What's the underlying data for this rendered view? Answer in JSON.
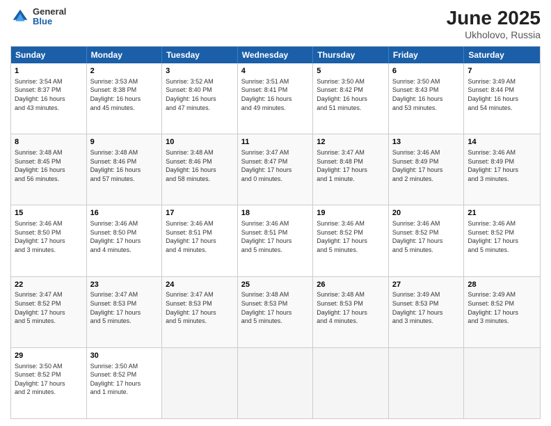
{
  "header": {
    "logo_general": "General",
    "logo_blue": "Blue",
    "title": "June 2025",
    "location": "Ukholovo, Russia"
  },
  "weekdays": [
    "Sunday",
    "Monday",
    "Tuesday",
    "Wednesday",
    "Thursday",
    "Friday",
    "Saturday"
  ],
  "rows": [
    [
      {
        "day": "1",
        "info": "Sunrise: 3:54 AM\nSunset: 8:37 PM\nDaylight: 16 hours\nand 43 minutes."
      },
      {
        "day": "2",
        "info": "Sunrise: 3:53 AM\nSunset: 8:38 PM\nDaylight: 16 hours\nand 45 minutes."
      },
      {
        "day": "3",
        "info": "Sunrise: 3:52 AM\nSunset: 8:40 PM\nDaylight: 16 hours\nand 47 minutes."
      },
      {
        "day": "4",
        "info": "Sunrise: 3:51 AM\nSunset: 8:41 PM\nDaylight: 16 hours\nand 49 minutes."
      },
      {
        "day": "5",
        "info": "Sunrise: 3:50 AM\nSunset: 8:42 PM\nDaylight: 16 hours\nand 51 minutes."
      },
      {
        "day": "6",
        "info": "Sunrise: 3:50 AM\nSunset: 8:43 PM\nDaylight: 16 hours\nand 53 minutes."
      },
      {
        "day": "7",
        "info": "Sunrise: 3:49 AM\nSunset: 8:44 PM\nDaylight: 16 hours\nand 54 minutes."
      }
    ],
    [
      {
        "day": "8",
        "info": "Sunrise: 3:48 AM\nSunset: 8:45 PM\nDaylight: 16 hours\nand 56 minutes."
      },
      {
        "day": "9",
        "info": "Sunrise: 3:48 AM\nSunset: 8:46 PM\nDaylight: 16 hours\nand 57 minutes."
      },
      {
        "day": "10",
        "info": "Sunrise: 3:48 AM\nSunset: 8:46 PM\nDaylight: 16 hours\nand 58 minutes."
      },
      {
        "day": "11",
        "info": "Sunrise: 3:47 AM\nSunset: 8:47 PM\nDaylight: 17 hours\nand 0 minutes."
      },
      {
        "day": "12",
        "info": "Sunrise: 3:47 AM\nSunset: 8:48 PM\nDaylight: 17 hours\nand 1 minute."
      },
      {
        "day": "13",
        "info": "Sunrise: 3:46 AM\nSunset: 8:49 PM\nDaylight: 17 hours\nand 2 minutes."
      },
      {
        "day": "14",
        "info": "Sunrise: 3:46 AM\nSunset: 8:49 PM\nDaylight: 17 hours\nand 3 minutes."
      }
    ],
    [
      {
        "day": "15",
        "info": "Sunrise: 3:46 AM\nSunset: 8:50 PM\nDaylight: 17 hours\nand 3 minutes."
      },
      {
        "day": "16",
        "info": "Sunrise: 3:46 AM\nSunset: 8:50 PM\nDaylight: 17 hours\nand 4 minutes."
      },
      {
        "day": "17",
        "info": "Sunrise: 3:46 AM\nSunset: 8:51 PM\nDaylight: 17 hours\nand 4 minutes."
      },
      {
        "day": "18",
        "info": "Sunrise: 3:46 AM\nSunset: 8:51 PM\nDaylight: 17 hours\nand 5 minutes."
      },
      {
        "day": "19",
        "info": "Sunrise: 3:46 AM\nSunset: 8:52 PM\nDaylight: 17 hours\nand 5 minutes."
      },
      {
        "day": "20",
        "info": "Sunrise: 3:46 AM\nSunset: 8:52 PM\nDaylight: 17 hours\nand 5 minutes."
      },
      {
        "day": "21",
        "info": "Sunrise: 3:46 AM\nSunset: 8:52 PM\nDaylight: 17 hours\nand 5 minutes."
      }
    ],
    [
      {
        "day": "22",
        "info": "Sunrise: 3:47 AM\nSunset: 8:52 PM\nDaylight: 17 hours\nand 5 minutes."
      },
      {
        "day": "23",
        "info": "Sunrise: 3:47 AM\nSunset: 8:53 PM\nDaylight: 17 hours\nand 5 minutes."
      },
      {
        "day": "24",
        "info": "Sunrise: 3:47 AM\nSunset: 8:53 PM\nDaylight: 17 hours\nand 5 minutes."
      },
      {
        "day": "25",
        "info": "Sunrise: 3:48 AM\nSunset: 8:53 PM\nDaylight: 17 hours\nand 5 minutes."
      },
      {
        "day": "26",
        "info": "Sunrise: 3:48 AM\nSunset: 8:53 PM\nDaylight: 17 hours\nand 4 minutes."
      },
      {
        "day": "27",
        "info": "Sunrise: 3:49 AM\nSunset: 8:53 PM\nDaylight: 17 hours\nand 3 minutes."
      },
      {
        "day": "28",
        "info": "Sunrise: 3:49 AM\nSunset: 8:52 PM\nDaylight: 17 hours\nand 3 minutes."
      }
    ],
    [
      {
        "day": "29",
        "info": "Sunrise: 3:50 AM\nSunset: 8:52 PM\nDaylight: 17 hours\nand 2 minutes."
      },
      {
        "day": "30",
        "info": "Sunrise: 3:50 AM\nSunset: 8:52 PM\nDaylight: 17 hours\nand 1 minute."
      },
      {
        "day": "",
        "info": ""
      },
      {
        "day": "",
        "info": ""
      },
      {
        "day": "",
        "info": ""
      },
      {
        "day": "",
        "info": ""
      },
      {
        "day": "",
        "info": ""
      }
    ]
  ]
}
